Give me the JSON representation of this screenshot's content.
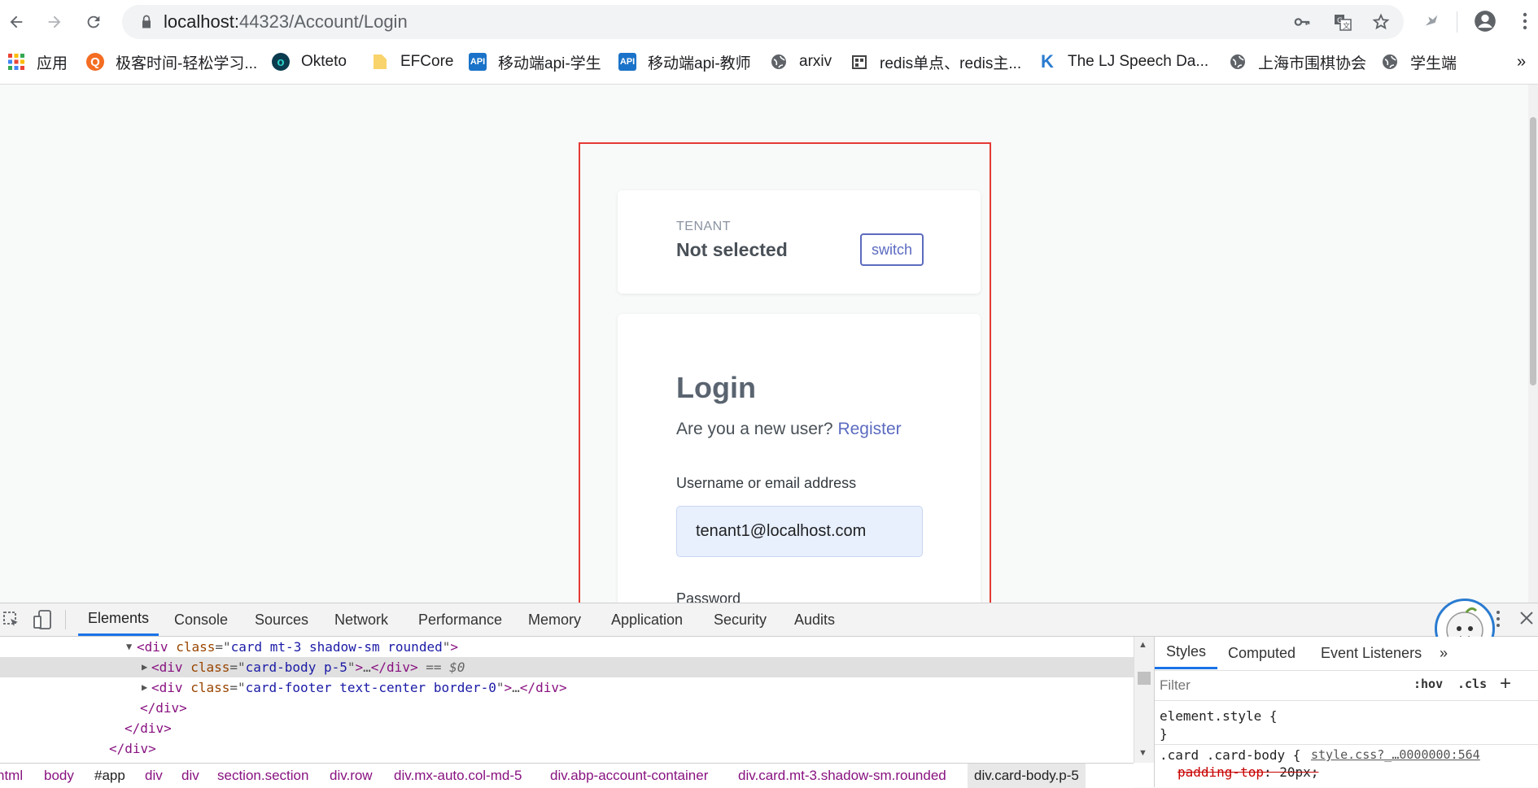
{
  "browser": {
    "url_host": "localhost:",
    "url_rest": "44323/Account/Login",
    "bookmarks": [
      {
        "label": "应用",
        "icon": "apps-grid-icon"
      },
      {
        "label": "极客时间-轻松学习...",
        "icon": "geektime-icon"
      },
      {
        "label": "Okteto",
        "icon": "okteto-icon"
      },
      {
        "label": "EFCore",
        "icon": "folder-icon"
      },
      {
        "label": "移动端api-学生",
        "icon": "api-icon"
      },
      {
        "label": "移动端api-教师",
        "icon": "api-icon"
      },
      {
        "label": "arxiv",
        "icon": "globe-icon"
      },
      {
        "label": "redis单点、redis主...",
        "icon": "site-icon"
      },
      {
        "label": "The LJ Speech Da...",
        "icon": "k-icon"
      },
      {
        "label": "上海市围棋协会",
        "icon": "globe-icon"
      },
      {
        "label": "学生端",
        "icon": "globe-icon"
      }
    ],
    "more_bookmarks": "»"
  },
  "tenant_card": {
    "label": "TENANT",
    "value": "Not selected",
    "switch_label": "switch"
  },
  "login_card": {
    "title": "Login",
    "new_user_text": "Are you a new user? ",
    "register_link": "Register",
    "username_label": "Username or email address",
    "username_value": "tenant1@localhost.com",
    "password_label": "Password"
  },
  "devtools": {
    "tabs": [
      "Elements",
      "Console",
      "Sources",
      "Network",
      "Performance",
      "Memory",
      "Application",
      "Security",
      "Audits"
    ],
    "active_tab": "Elements",
    "lines": {
      "l1_tag": "div",
      "l1_attr": "class",
      "l1_val": "card mt-3 shadow-sm rounded",
      "l2_tag": "div",
      "l2_attr": "class",
      "l2_val": "card-body p-5",
      "l2_ellipsis": "…",
      "l2_marker": " == $0",
      "l3_tag": "div",
      "l3_attr": "class",
      "l3_val": "card-footer text-center border-0",
      "l3_ellipsis": "…",
      "l4": "</div>",
      "l5": "</div>",
      "l6": "</div>"
    },
    "breadcrumbs": [
      "html",
      "body",
      "#app",
      "div",
      "div",
      "section.section",
      "div.row",
      "div.mx-auto.col-md-5",
      "div.abp-account-container",
      "div.card.mt-3.shadow-sm.rounded",
      "div.card-body.p-5"
    ],
    "styles_tabs": [
      "Styles",
      "Computed",
      "Event Listeners"
    ],
    "styles_more": "»",
    "filter_placeholder": "Filter",
    "hov": ":hov",
    "cls": ".cls",
    "plus": "+",
    "element_style_open": "element.style {",
    "element_style_close": "}",
    "rule_selector": ".card .card-body {",
    "rule_source": "style.css?_…0000000:564",
    "rule_prop": "padding-top",
    "rule_value": ": 20px;"
  }
}
